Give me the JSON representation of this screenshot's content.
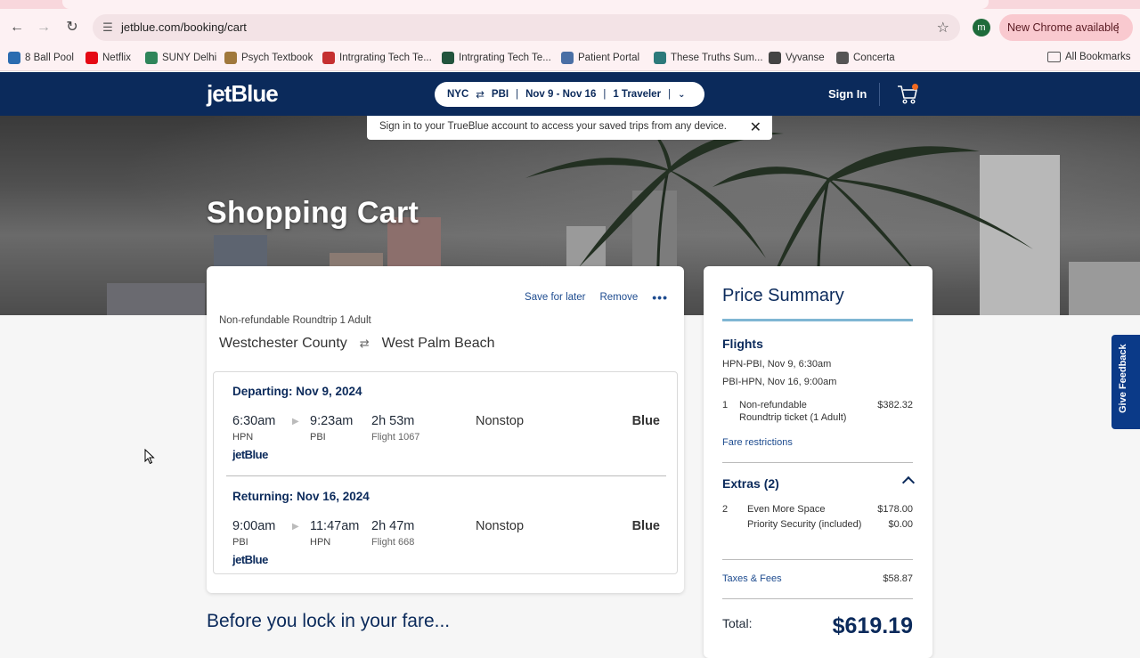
{
  "browser": {
    "url": "jetblue.com/booking/cart",
    "update_label": "New Chrome available",
    "profile_initial": "m"
  },
  "bookmarks": [
    {
      "label": "8 Ball Pool",
      "color": "#2b6cb0"
    },
    {
      "label": "Netflix",
      "color": "#e50914"
    },
    {
      "label": "SUNY Delhi",
      "color": "#2f855a"
    },
    {
      "label": "Psych Textbook",
      "color": "#a0783c"
    },
    {
      "label": "Intrgrating Tech Te...",
      "color": "#c53030"
    },
    {
      "label": "Intrgrating Tech Te...",
      "color": "#22543d"
    },
    {
      "label": "Patient Portal",
      "color": "#4a6fa5"
    },
    {
      "label": "These Truths Sum...",
      "color": "#2c7a7b"
    },
    {
      "label": "Vyvanse",
      "color": "#444444"
    },
    {
      "label": "Concerta",
      "color": "#555555"
    }
  ],
  "all_bookmarks_label": "All Bookmarks",
  "header": {
    "logo": "jetBlue",
    "trip_origin": "NYC",
    "trip_dest": "PBI",
    "trip_dates": "Nov 9 - Nov 16",
    "trip_travelers": "1 Traveler",
    "sign_in": "Sign In"
  },
  "banner": {
    "text": "Sign in to your TrueBlue account to access your saved trips from any device."
  },
  "hero": {
    "title": "Shopping Cart"
  },
  "cart": {
    "save_for_later": "Save for later",
    "remove": "Remove",
    "fare_type": "Non-refundable Roundtrip 1 Adult",
    "origin": "Westchester County",
    "destination": "West Palm Beach",
    "departing": {
      "title": "Departing: Nov 9, 2024",
      "depart_time": "6:30am",
      "depart_code": "HPN",
      "arrive_time": "9:23am",
      "arrive_code": "PBI",
      "duration": "2h 53m",
      "flight": "Flight 1067",
      "stops": "Nonstop",
      "fare_class": "Blue",
      "airline": "jetBlue"
    },
    "returning": {
      "title": "Returning: Nov 16, 2024",
      "depart_time": "9:00am",
      "depart_code": "PBI",
      "arrive_time": "11:47am",
      "arrive_code": "HPN",
      "duration": "2h 47m",
      "flight": "Flight 668",
      "stops": "Nonstop",
      "fare_class": "Blue",
      "airline": "jetBlue"
    }
  },
  "lock_title": "Before you lock in your fare...",
  "summary": {
    "title": "Price Summary",
    "flights_heading": "Flights",
    "flight_line_1": "HPN-PBI, Nov 9, 6:30am",
    "flight_line_2": "PBI-HPN, Nov 16, 9:00am",
    "ticket_qty": "1",
    "ticket_desc_1": "Non-refundable",
    "ticket_desc_2": "Roundtrip ticket (1 Adult)",
    "ticket_amount": "$382.32",
    "fare_restrictions": "Fare restrictions",
    "extras_heading": "Extras (2)",
    "extras_qty": "2",
    "extra_1": "Even More Space",
    "extra_1_amount": "$178.00",
    "extra_2": "Priority Security (included)",
    "extra_2_amount": "$0.00",
    "taxes_label": "Taxes & Fees",
    "taxes_amount": "$58.87",
    "total_label": "Total:",
    "total_amount": "$619.19"
  },
  "feedback_label": "Give Feedback"
}
